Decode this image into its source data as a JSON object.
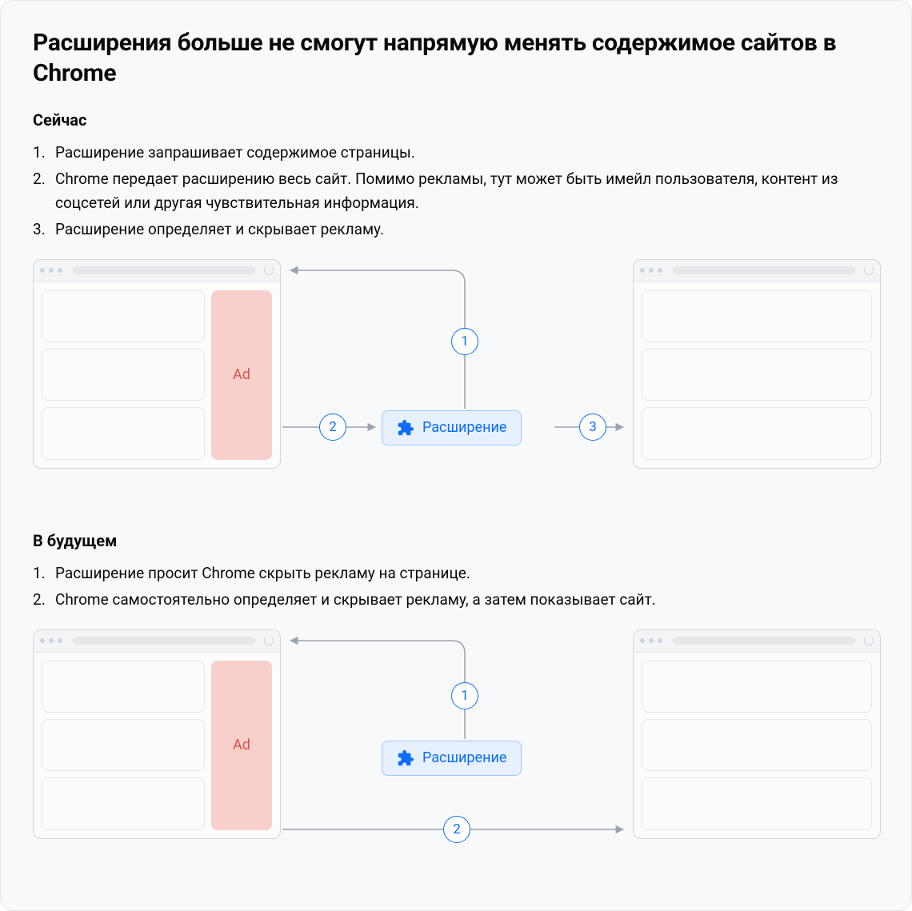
{
  "title": "Расширения больше не смогут напрямую менять содержимое сайтов в Chrome",
  "section_now": {
    "heading": "Сейчас",
    "steps": [
      "Расширение запрашивает содержимое страницы.",
      "Chrome передает расширению весь сайт. Помимо рекламы, тут может быть имейл пользователя, контент из соцсетей или другая чувствительная информация.",
      "Расширение определяет и скрывает рекламу."
    ]
  },
  "section_future": {
    "heading": "В будущем",
    "steps": [
      "Расширение просит Chrome скрыть рекламу на странице.",
      "Chrome самостоятельно определяет и скрывает рекламу, а затем показывает сайт."
    ]
  },
  "diagram": {
    "ad_label": "Ad",
    "extension_label": "Расширение",
    "step_badges": {
      "one": "1",
      "two": "2",
      "three": "3"
    }
  },
  "colors": {
    "accent": "#0d6efd",
    "ad_bg": "#f8d0cb",
    "ad_text": "#d9534f",
    "border": "#d1d5db"
  }
}
